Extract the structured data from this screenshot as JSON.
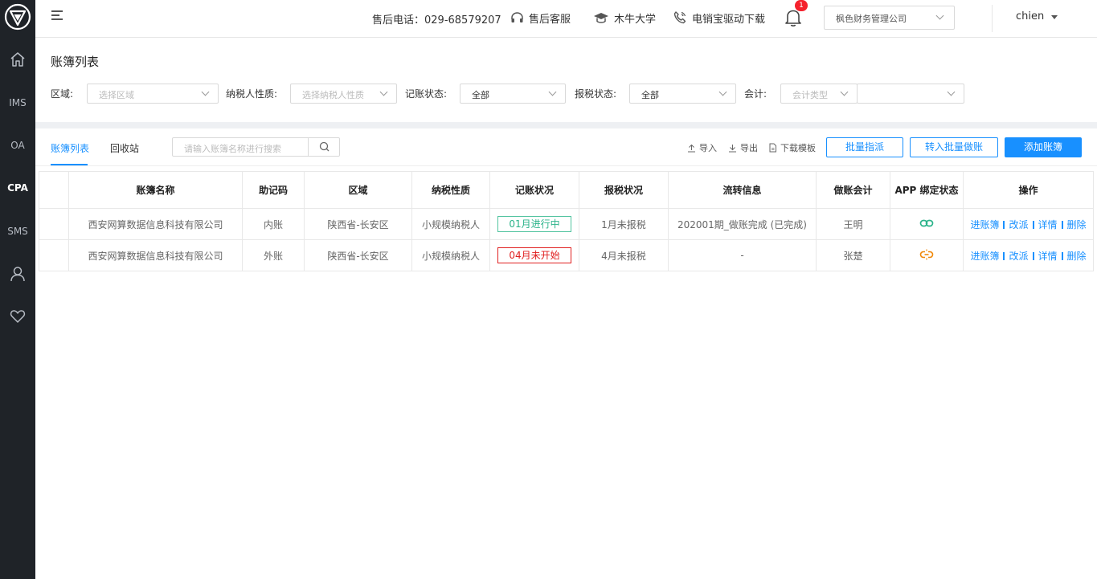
{
  "colors": {
    "sidebar_bg": "#1f2328",
    "primary": "#1890ff",
    "tag_green": "#2bb38a",
    "tag_red": "#e02020",
    "badge": "#f5222d"
  },
  "sidebar": {
    "items": [
      {
        "name": "home",
        "icon": "home-icon",
        "label": ""
      },
      {
        "name": "ims",
        "icon": "",
        "label": "IMS"
      },
      {
        "name": "oa",
        "icon": "",
        "label": "OA"
      },
      {
        "name": "cpa",
        "icon": "",
        "label": "CPA"
      },
      {
        "name": "sms",
        "icon": "",
        "label": "SMS"
      },
      {
        "name": "user",
        "icon": "user-icon",
        "label": ""
      },
      {
        "name": "favorite",
        "icon": "heart-icon",
        "label": ""
      }
    ],
    "active": "cpa"
  },
  "header": {
    "hotline": "售后电话：029-68579207",
    "customer_service": "售后客服",
    "university": "木牛大学",
    "driver_download": "电销宝驱动下载",
    "notification_count": "1",
    "company": "枫色财务管理公司",
    "username": "chien"
  },
  "page": {
    "title": "账簿列表"
  },
  "filters": {
    "region": {
      "label": "区域:",
      "placeholder": "选择区域"
    },
    "taxpayer": {
      "label": "纳税人性质:",
      "placeholder": "选择纳税人性质"
    },
    "bookkeeping": {
      "label": "记账状态:",
      "value": "全部"
    },
    "tax_filing": {
      "label": "报税状态:",
      "value": "全部"
    },
    "accountant": {
      "label": "会计:",
      "placeholder": "会计类型",
      "value": ""
    }
  },
  "tabs": [
    {
      "label": "账簿列表",
      "active": true
    },
    {
      "label": "回收站",
      "active": false
    }
  ],
  "search": {
    "placeholder": "请输入账簿名称进行搜索"
  },
  "toolbar": {
    "import": "导入",
    "export": "导出",
    "template": "下载模板",
    "batch_assign": "批量指派",
    "batch_bookkeeping": "转入批量做账",
    "add_book": "添加账簿"
  },
  "table": {
    "columns": [
      "",
      "账簿名称",
      "助记码",
      "区域",
      "纳税性质",
      "记账状况",
      "报税状况",
      "流转信息",
      "做账会计",
      "APP 绑定状态",
      "操作"
    ],
    "rows": [
      {
        "name": "西安网算数据信息科技有限公司",
        "code": "内账",
        "region": "陕西省-长安区",
        "tax_type": "小规模纳税人",
        "bookkeeping": "01月进行中",
        "bookkeeping_color": "green",
        "tax_status": "1月未报税",
        "transfer": "202001期_做账完成 (已完成)",
        "accountant": "王明",
        "app_bind": "linked",
        "ops": [
          "进账簿",
          "改派",
          "详情",
          "删除"
        ]
      },
      {
        "name": "西安网算数据信息科技有限公司",
        "code": "外账",
        "region": "陕西省-长安区",
        "tax_type": "小规模纳税人",
        "bookkeeping": "04月未开始",
        "bookkeeping_color": "red",
        "tax_status": "4月未报税",
        "transfer": "-",
        "accountant": "张楚",
        "app_bind": "unlinked",
        "ops": [
          "进账簿",
          "改派",
          "详情",
          "删除"
        ]
      }
    ]
  }
}
